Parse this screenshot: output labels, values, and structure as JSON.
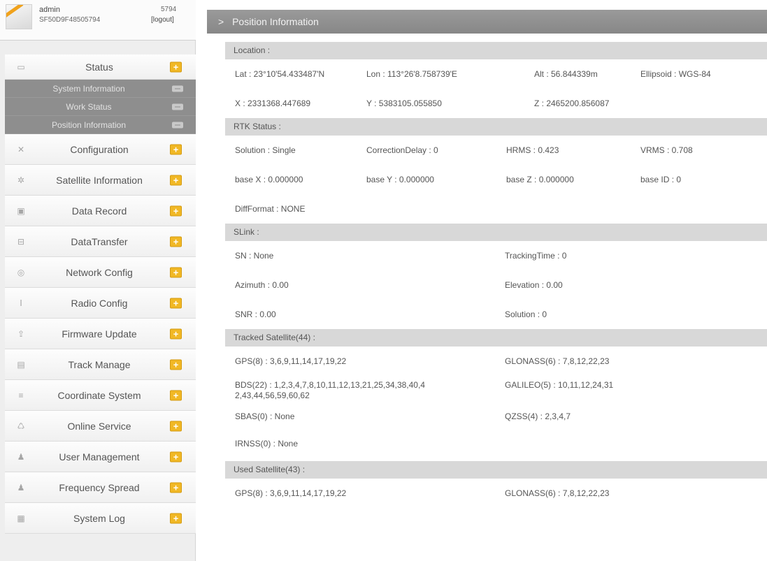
{
  "user": {
    "name": "admin",
    "serial": "SF50D9F48505794",
    "code": "5794",
    "logout": "[logout]"
  },
  "menu": {
    "status": "Status",
    "submenu": [
      "System Information",
      "Work Status",
      "Position Information"
    ],
    "items": [
      {
        "label": "Configuration",
        "icon": "tools-icon"
      },
      {
        "label": "Satellite Information",
        "icon": "satellite-icon"
      },
      {
        "label": "Data Record",
        "icon": "record-icon"
      },
      {
        "label": "DataTransfer",
        "icon": "transfer-icon"
      },
      {
        "label": "Network Config",
        "icon": "network-icon"
      },
      {
        "label": "Radio Config",
        "icon": "radio-icon"
      },
      {
        "label": "Firmware Update",
        "icon": "upload-icon"
      },
      {
        "label": "Track Manage",
        "icon": "track-icon"
      },
      {
        "label": "Coordinate System",
        "icon": "coordinate-icon"
      },
      {
        "label": "Online Service",
        "icon": "service-icon"
      },
      {
        "label": "User Management",
        "icon": "user-icon"
      },
      {
        "label": "Frequency Spread",
        "icon": "frequency-icon"
      },
      {
        "label": "System Log",
        "icon": "log-icon"
      }
    ]
  },
  "page": {
    "title": "Position Information"
  },
  "location": {
    "heading": "Location :",
    "lat": "Lat : 23°10'54.433487'N",
    "lon": "Lon : 113°26'8.758739'E",
    "alt": "Alt : 56.844339m",
    "ellipsoid": "Ellipsoid : WGS-84",
    "x": "X : 2331368.447689",
    "y": "Y : 5383105.055850",
    "z": "Z : 2465200.856087"
  },
  "rtk": {
    "heading": "RTK Status :",
    "solution": "Solution : Single",
    "correction_delay": "CorrectionDelay : 0",
    "hrms": "HRMS : 0.423",
    "vrms": "VRMS : 0.708",
    "base_x": "base X : 0.000000",
    "base_y": "base Y : 0.000000",
    "base_z": "base Z : 0.000000",
    "base_id": "base ID : 0",
    "diff_format": "DiffFormat : NONE"
  },
  "slink": {
    "heading": "SLink :",
    "sn": "SN : None",
    "tracking_time": "TrackingTime : 0",
    "azimuth": "Azimuth : 0.00",
    "elevation": "Elevation : 0.00",
    "snr": "SNR : 0.00",
    "solution": "Solution : 0"
  },
  "tracked": {
    "heading": "Tracked Satellite(44) :",
    "gps": "GPS(8) : 3,6,9,11,14,17,19,22",
    "glonass": "GLONASS(6) : 7,8,12,22,23",
    "bds": "BDS(22) : 1,2,3,4,7,8,10,11,12,13,21,25,34,38,40,4 2,43,44,56,59,60,62",
    "galileo": "GALILEO(5) : 10,11,12,24,31",
    "sbas": "SBAS(0) : None",
    "qzss": "QZSS(4) : 2,3,4,7",
    "irnss": "IRNSS(0) : None"
  },
  "used": {
    "heading": "Used Satellite(43) :",
    "gps": "GPS(8) : 3,6,9,11,14,17,19,22",
    "glonass": "GLONASS(6) : 7,8,12,22,23"
  }
}
